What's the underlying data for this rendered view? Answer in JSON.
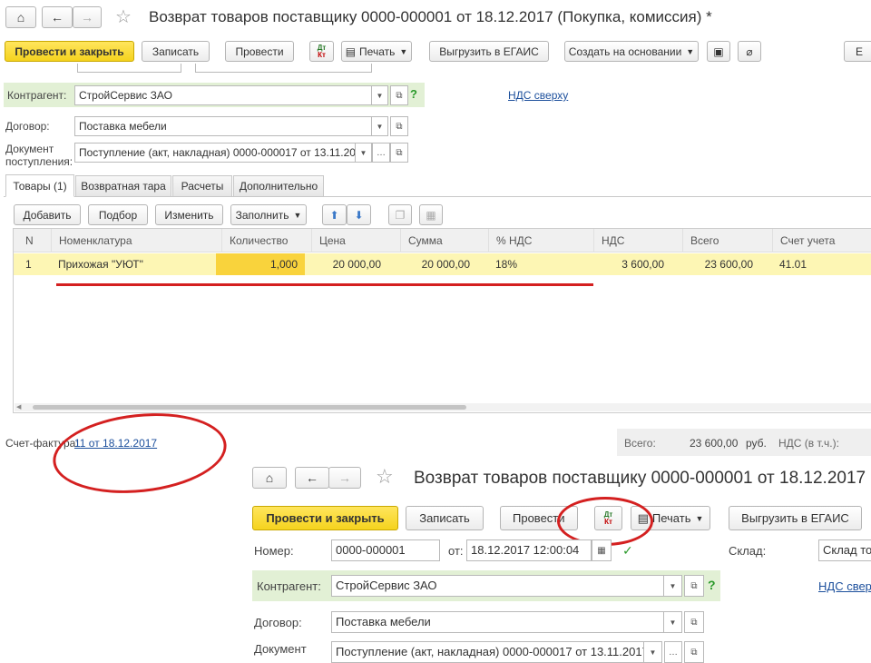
{
  "top": {
    "title": "Возврат товаров поставщику 0000-000001 от 18.12.2017 (Покупка, комиссия) *",
    "toolbar": {
      "post_close": "Провести и закрыть",
      "save": "Записать",
      "post": "Провести",
      "print": "Печать",
      "egais": "Выгрузить в ЕГАИС",
      "create_based": "Создать на основании",
      "more": "E"
    },
    "counterparty_label": "Контрагент:",
    "counterparty_value": "СтройСервис ЗАО",
    "vat_link": "НДС сверху",
    "contract_label": "Договор:",
    "contract_value": "Поставка мебели",
    "receipt_label_1": "Документ",
    "receipt_label_2": "поступления:",
    "receipt_value": "Поступление (акт, накладная) 0000-000017 от 13.11.2017",
    "tabs": [
      "Товары (1)",
      "Возвратная тара",
      "Расчеты",
      "Дополнительно"
    ],
    "table_toolbar": {
      "add": "Добавить",
      "select": "Подбор",
      "change": "Изменить",
      "fill": "Заполнить"
    },
    "columns": [
      "N",
      "Номенклатура",
      "Количество",
      "Цена",
      "Сумма",
      "% НДС",
      "НДС",
      "Всего",
      "Счет учета"
    ],
    "rows": [
      {
        "n": "1",
        "item": "Прихожая \"УЮТ\"",
        "qty": "1,000",
        "price": "20 000,00",
        "sum": "20 000,00",
        "vat_rate": "18%",
        "vat": "3 600,00",
        "total": "23 600,00",
        "account": "41.01"
      }
    ],
    "invoice_label": "Счет-фактура:",
    "invoice_link": "11 от 18.12.2017",
    "totals": {
      "total_label": "Всего:",
      "total_value": "23 600,00",
      "currency": "руб.",
      "vat_label": "НДС (в т.ч.):"
    }
  },
  "bottom": {
    "title": "Возврат товаров поставщику 0000-000001 от 18.12.2017",
    "toolbar": {
      "post_close": "Провести и закрыть",
      "save": "Записать",
      "post": "Провести",
      "print": "Печать",
      "egais": "Выгрузить в ЕГАИС"
    },
    "number_label": "Номер:",
    "number_value": "0000-000001",
    "from_label": "от:",
    "date_value": "18.12.2017 12:00:04",
    "warehouse_label": "Склад:",
    "warehouse_value": "Склад то",
    "counterparty_label": "Контрагент:",
    "counterparty_value": "СтройСервис ЗАО",
    "vat_link": "НДС свер",
    "contract_label": "Договор:",
    "contract_value": "Поставка мебели",
    "receipt_label": "Документ",
    "receipt_value": "Поступление (акт, накладная) 0000-000017 от 13.11.2017"
  },
  "icons": {
    "dtkt_top": "Дт",
    "dtkt_bottom": "Кт"
  },
  "colors": {
    "accent_yellow": "#f5d31e",
    "row_highlight": "#fdf6b4",
    "green_band": "#e2f0d5",
    "red_annotation": "#d42020",
    "link_blue": "#1c4f9c"
  }
}
